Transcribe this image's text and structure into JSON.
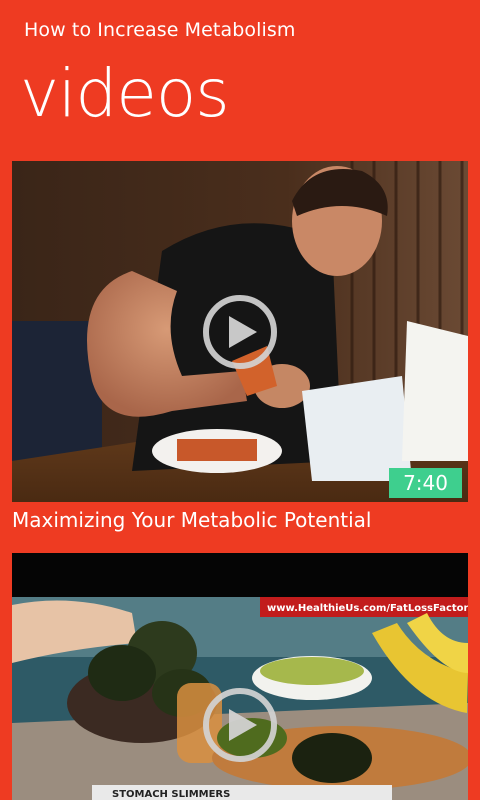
{
  "app": {
    "title": "How to Increase Metabolism"
  },
  "page": {
    "title": "videos"
  },
  "videos": [
    {
      "title": "Maximizing Your Metabolic Potential",
      "duration": "7:40"
    },
    {
      "title": "",
      "duration": "",
      "watermark": "www.HealthieUs.com/FatLossFactor",
      "caption": "STOMACH SLIMMERS"
    }
  ],
  "colors": {
    "background": "#ee3b22",
    "duration_badge": "#3ecf8e"
  }
}
